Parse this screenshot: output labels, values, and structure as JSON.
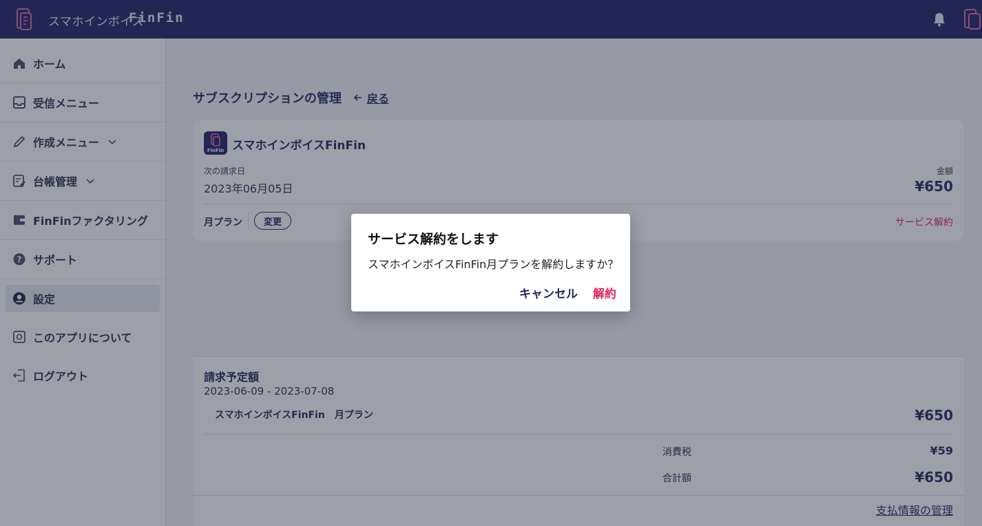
{
  "header": {
    "brand_jp": "スマホインボイス",
    "brand_en": "FinFin",
    "icons": {
      "logo": "app-logo-icon",
      "bell": "bell-icon",
      "avatar": "user-avatar"
    }
  },
  "sidebar": {
    "items": [
      {
        "label": "ホーム",
        "icon": "home-icon"
      },
      {
        "label": "受信メニュー",
        "icon": "inbox-icon"
      },
      {
        "label": "作成メニュー",
        "icon": "pencil-icon",
        "has_chevron": true
      },
      {
        "label": "台帳管理",
        "icon": "ledger-icon",
        "has_chevron": true
      },
      {
        "label": "FinFinファクタリング",
        "icon": "wallet-icon"
      },
      {
        "label": "サポート",
        "icon": "help-icon"
      },
      {
        "label": "設定",
        "icon": "user-circle-icon",
        "active": true
      },
      {
        "label": "このアプリについて",
        "icon": "info-box-icon"
      },
      {
        "label": "ログアウト",
        "icon": "logout-icon"
      }
    ]
  },
  "main": {
    "title": "サブスクリプションの管理",
    "back_label": "戻る",
    "subscription": {
      "app_name": "スマホインボイスFinFin",
      "icon_text": "FinFin",
      "next_billing_label": "次の請求日",
      "next_billing_date": "2023年06月05日",
      "amount_label": "金額",
      "amount": "¥650",
      "plan": "月プラン",
      "change_label": "変更",
      "cancel_service_label": "サービス解約"
    },
    "billing": {
      "title": "請求予定額",
      "period": "2023-06-09 - 2023-07-08",
      "item_name": "スマホインボイスFinFin　月プラン",
      "item_price": "¥650",
      "tax_label": "消費税",
      "tax": "¥59",
      "total_label": "合計額",
      "total": "¥650",
      "payment_link": "支払情報の管理"
    }
  },
  "dialog": {
    "title": "サービス解約をします",
    "message": "スマホインボイスFinFin月プランを解約しますか？",
    "cancel_label": "キャンセル",
    "confirm_label": "解約"
  },
  "colors": {
    "header_bg": "#1c2167",
    "primary": "#22275a",
    "danger": "#e0245e",
    "page_bg": "#f3f4f8"
  }
}
